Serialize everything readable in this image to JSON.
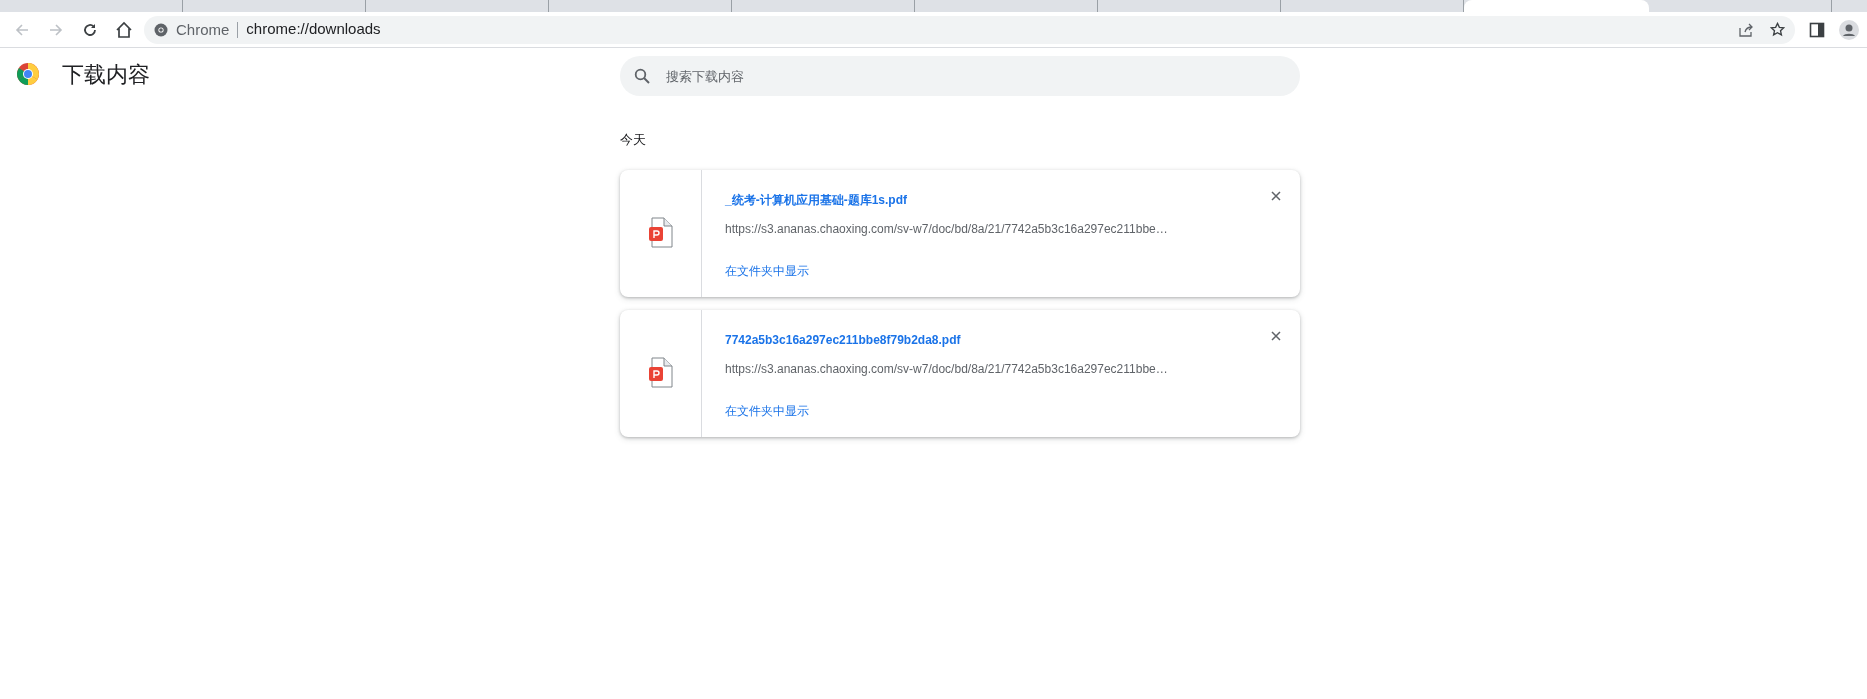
{
  "tabs": [
    {
      "selected": false
    },
    {
      "selected": false
    },
    {
      "selected": false
    },
    {
      "selected": false
    },
    {
      "selected": false
    },
    {
      "selected": false
    },
    {
      "selected": false
    },
    {
      "selected": false
    },
    {
      "selected": true
    },
    {
      "selected": false
    }
  ],
  "address_bar": {
    "site_label": "Chrome",
    "url": "chrome://downloads"
  },
  "page": {
    "title": "下载内容",
    "search": {
      "placeholder": "搜索下载内容"
    },
    "date_heading": "今天"
  },
  "downloads": [
    {
      "file_name": "_统考-计算机应用基础-题库1s.pdf",
      "source_url": "https://s3.ananas.chaoxing.com/sv-w7/doc/bd/8a/21/7742a5b3c16a297ec211bbe…",
      "action": "在文件夹中显示"
    },
    {
      "file_name": "7742a5b3c16a297ec211bbe8f79b2da8.pdf",
      "source_url": "https://s3.ananas.chaoxing.com/sv-w7/doc/bd/8a/21/7742a5b3c16a297ec211bbe…",
      "action": "在文件夹中显示"
    }
  ]
}
